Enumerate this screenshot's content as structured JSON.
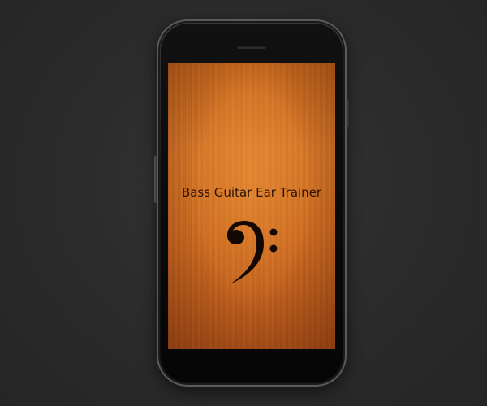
{
  "app": {
    "title": "Bass Guitar Ear Trainer"
  },
  "icons": {
    "logo": "bass-clef-icon"
  },
  "colors": {
    "background": "#2c2c2c",
    "screen_wood": "#d7782a",
    "title_text": "#2a1206"
  }
}
